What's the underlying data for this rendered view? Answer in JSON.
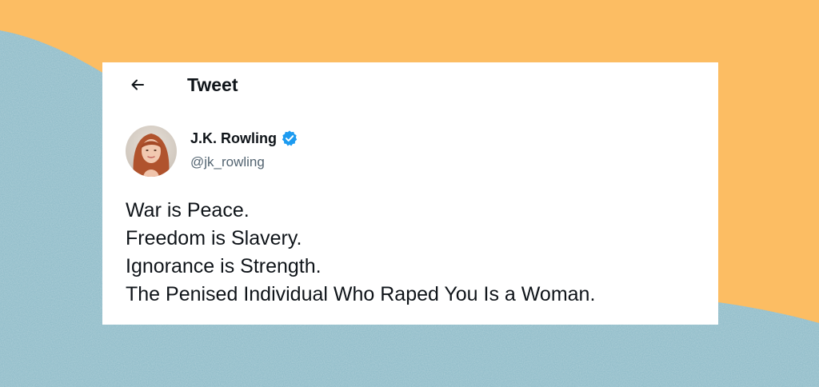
{
  "colors": {
    "background_blue": "#8ebbc8",
    "background_orange": "#fcbd63",
    "card": "#ffffff",
    "text_primary": "#0f1419",
    "text_secondary": "#536471",
    "verified_blue": "#1d9bf0"
  },
  "header": {
    "back_icon": "arrow-left-icon",
    "title": "Tweet"
  },
  "author": {
    "name": "J.K. Rowling",
    "handle": "@jk_rowling",
    "verified_icon": "verified-badge-icon",
    "avatar_icon": "avatar-photo"
  },
  "tweet": {
    "lines": [
      "War is Peace.",
      "Freedom is Slavery.",
      "Ignorance is Strength.",
      "The Penised Individual Who Raped You Is a Woman."
    ]
  }
}
